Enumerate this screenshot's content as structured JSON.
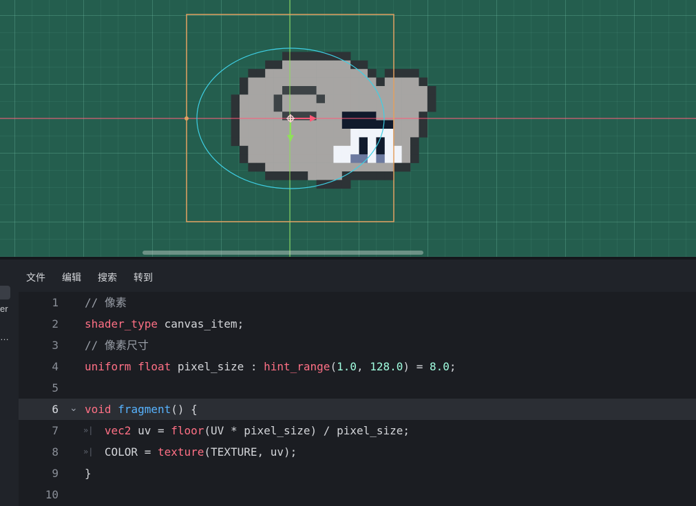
{
  "menu": [
    "文件",
    "编辑",
    "搜索",
    "转到"
  ],
  "left_stub": {
    "text1": "er",
    "text2": "…"
  },
  "colors": {
    "grid_bg": "#245e4e",
    "selection_frame": "#e2a060",
    "x_axis": "#ff5a78",
    "y_axis": "#8fe05a",
    "collision_ellipse": "#3ecfe4",
    "keyword": "#ff7085",
    "function": "#57b3ff",
    "number": "#a1ffe0",
    "comment": "#9a9fa8"
  },
  "sprite": {
    "palette": {
      "L": "#a7a5a3",
      "M": "#8e8c8a",
      "D": "#3d4346",
      "E": "#2d3336",
      "N": "#101a2c",
      "W": "#f1f4fa",
      "B": "#6c7aa0"
    },
    "rows": [
      "............................",
      "..........EEEEEEEE..........",
      "........EELLLLLLLLEE........",
      "......EELLLLLLLLLLLLE.EEEE..",
      ".....ELLLLLLLLLLLLLLLELLLLE.",
      ".....ELLLLDDDDLLLLLLLLLLLLLE",
      "....ELLLLDLLLLDLLLLLLLLLLLLE",
      "....ELLLLDLLLLLLLLLLLLLLLLLE",
      "....ELLLLLDDDDLLLNNNNLLLLLE.",
      "....ELLLLLLLLLLLLNNNNNNLLLE.",
      "....ELLLLLLLLLLLLLWWWWWLLLE.",
      "....ELLLLLLLLLLLLLWNWNWLLE..",
      ".....ELLLLLLLLLLWWWNWNWWLE..",
      ".....ELLLLLLLLLLWWBBWBWWLE..",
      "......EELLLLLLLLLLLLLLLEE...",
      "........EEEEELLLLEEEEEE.....",
      "..............EEEE.........."
    ]
  },
  "code_lines": [
    {
      "n": "1",
      "fold": "",
      "indent": "",
      "tokens": [
        [
          "comment",
          "// 像素"
        ]
      ]
    },
    {
      "n": "2",
      "fold": "",
      "indent": "",
      "tokens": [
        [
          "keyword",
          "shader_type"
        ],
        [
          "ident",
          " canvas_item;"
        ]
      ]
    },
    {
      "n": "3",
      "fold": "",
      "indent": "",
      "tokens": [
        [
          "comment",
          "// 像素尺寸"
        ]
      ]
    },
    {
      "n": "4",
      "fold": "",
      "indent": "",
      "tokens": [
        [
          "keyword",
          "uniform"
        ],
        [
          "ident",
          " "
        ],
        [
          "type",
          "float"
        ],
        [
          "ident",
          " pixel_size : "
        ],
        [
          "builtin",
          "hint_range"
        ],
        [
          "ident",
          "("
        ],
        [
          "number",
          "1.0"
        ],
        [
          "ident",
          ", "
        ],
        [
          "number",
          "128.0"
        ],
        [
          "ident",
          ") = "
        ],
        [
          "number",
          "8.0"
        ],
        [
          "ident",
          ";"
        ]
      ]
    },
    {
      "n": "5",
      "fold": "",
      "indent": "",
      "tokens": []
    },
    {
      "n": "6",
      "fold": "⌄",
      "indent": "",
      "active": true,
      "tokens": [
        [
          "keyword",
          "void"
        ],
        [
          "ident",
          " "
        ],
        [
          "func",
          "fragment"
        ],
        [
          "ident",
          "() {"
        ]
      ]
    },
    {
      "n": "7",
      "fold": "",
      "indent": "»|",
      "tokens": [
        [
          "ident",
          "   "
        ],
        [
          "type",
          "vec2"
        ],
        [
          "ident",
          " uv = "
        ],
        [
          "builtin",
          "floor"
        ],
        [
          "ident",
          "(UV * pixel_size) / pixel_size;"
        ]
      ]
    },
    {
      "n": "8",
      "fold": "",
      "indent": "»|",
      "tokens": [
        [
          "ident",
          "   COLOR = "
        ],
        [
          "builtin",
          "texture"
        ],
        [
          "ident",
          "(TEXTURE, uv);"
        ]
      ]
    },
    {
      "n": "9",
      "fold": "",
      "indent": "",
      "tokens": [
        [
          "ident",
          "}"
        ]
      ]
    },
    {
      "n": "10",
      "fold": "",
      "indent": "",
      "tokens": []
    }
  ]
}
